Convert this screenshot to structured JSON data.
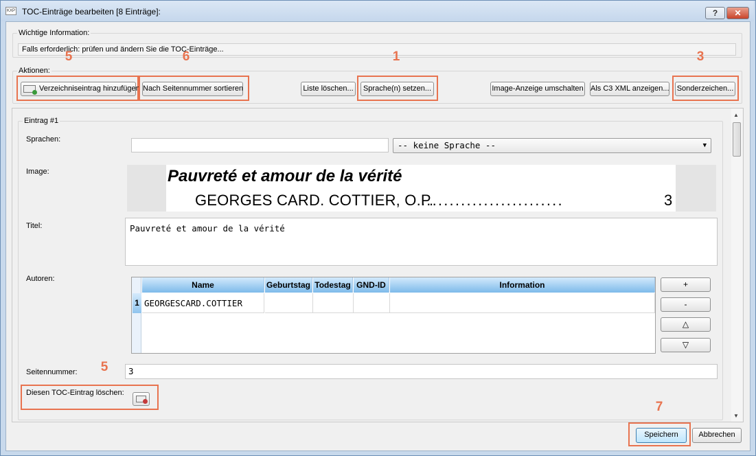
{
  "window": {
    "title": "TOC-Einträge bearbeiten [8 Einträge]:",
    "help_label": "?",
    "close_label": "✕"
  },
  "info": {
    "group_label": "Wichtige Information:",
    "text": "Falls erforderlich: prüfen und ändern Sie die TOC-Einträge..."
  },
  "actions": {
    "group_label": "Aktionen:",
    "add_entry": "Verzeichniseintrag hinzufügen",
    "sort_by_page": "Nach Seitennummer sortieren",
    "clear_list": "Liste löschen...",
    "set_languages": "Sprache(n) setzen...",
    "toggle_image": "Image-Anzeige umschalten",
    "show_xml": "Als C3 XML anzeigen...",
    "special_chars": "Sonderzeichen..."
  },
  "annotations": {
    "n1": "1",
    "n3": "3",
    "n5": "5",
    "n6": "6",
    "n7": "7"
  },
  "entry": {
    "group_label": "Eintrag #1",
    "languages_label": "Sprachen:",
    "languages_value": "",
    "language_select": "-- keine Sprache --",
    "image_label": "Image:",
    "image_title": "Pauvreté et amour de la vérité",
    "image_author": "GEORGES CARD. COTTIER, O.P.",
    "image_dots": ".........................",
    "image_page": "3",
    "title_label": "Titel:",
    "title_value": "Pauvreté et amour de la vérité",
    "authors_label": "Autoren:",
    "authors_columns": [
      "Name",
      "Geburtstag",
      "Todestag",
      "GND-ID",
      "Information"
    ],
    "authors_rows": [
      {
        "index": "1",
        "name": "GEORGESCARD.COTTIER",
        "birthday": "",
        "deathday": "",
        "gnd": "",
        "info": ""
      }
    ],
    "author_buttons": {
      "add": "+",
      "remove": "-",
      "up": "△",
      "down": "▽"
    },
    "page_label": "Seitennummer:",
    "page_value": "3",
    "delete_label": "Diesen TOC-Eintrag löschen:"
  },
  "footer": {
    "save": "Speichern",
    "cancel": "Abbrechen"
  },
  "colors": {
    "highlight": "#e8734f",
    "grid_header": "#7dbaea"
  }
}
